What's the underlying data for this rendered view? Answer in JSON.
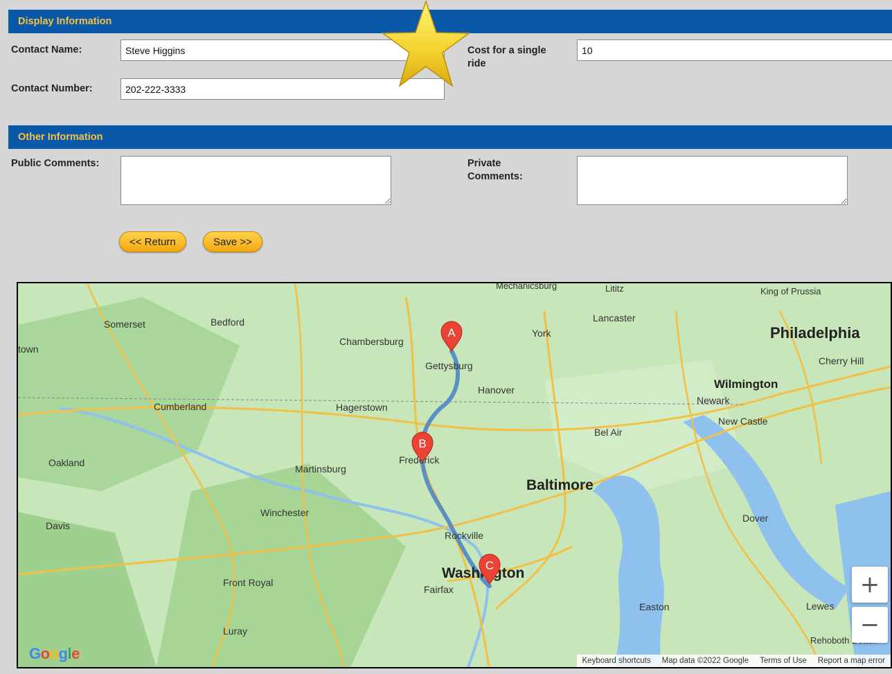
{
  "display_section": {
    "title": "Display Information",
    "contact_name_label": "Contact Name:",
    "contact_name_value": "Steve Higgins",
    "cost_label_line1": "Cost for a single",
    "cost_label_line2": "ride",
    "cost_value": "10",
    "contact_number_label": "Contact Number:",
    "contact_number_value": "202-222-3333"
  },
  "other_section": {
    "title": "Other Information",
    "public_comments_label": "Public Comments:",
    "public_comments_value": "",
    "private_comments_label_line1": "Private",
    "private_comments_label_line2": "Comments:",
    "private_comments_value": ""
  },
  "buttons": {
    "return_label": "<< Return",
    "save_label": "Save >>"
  },
  "decoration": {
    "star_color": "#f3d22a",
    "section_color": "#0a58a8",
    "section_title_color": "#f5c242",
    "button_color": "#f7b521"
  },
  "map": {
    "markers": [
      {
        "letter": "A"
      },
      {
        "letter": "B"
      },
      {
        "letter": "C"
      }
    ],
    "cities_big": [
      "Philadelphia",
      "Baltimore",
      "Washington",
      "Wilmington"
    ],
    "cities": [
      "Somerset",
      "Bedford",
      "Chambersburg",
      "York",
      "Lancaster",
      "Gettysburg",
      "Hanover",
      "Hagerstown",
      "Cumberland",
      "Newark",
      "New Castle",
      "Bel Air",
      "Frederick",
      "Oakland",
      "Martinsburg",
      "Winchester",
      "Davis",
      "Rockville",
      "Dover",
      "Fairfax",
      "Front Royal",
      "Easton",
      "Luray",
      "Lewes",
      "Rehoboth Beach",
      "King of Prussia",
      "Cherry Hill",
      "Mechanicsburg",
      "Lititz",
      "town"
    ],
    "zoom_in": "+",
    "zoom_out": "−",
    "logo_text": "Google",
    "attribution": [
      "Keyboard shortcuts",
      "Map data ©2022 Google",
      "Terms of Use",
      "Report a map error"
    ]
  }
}
